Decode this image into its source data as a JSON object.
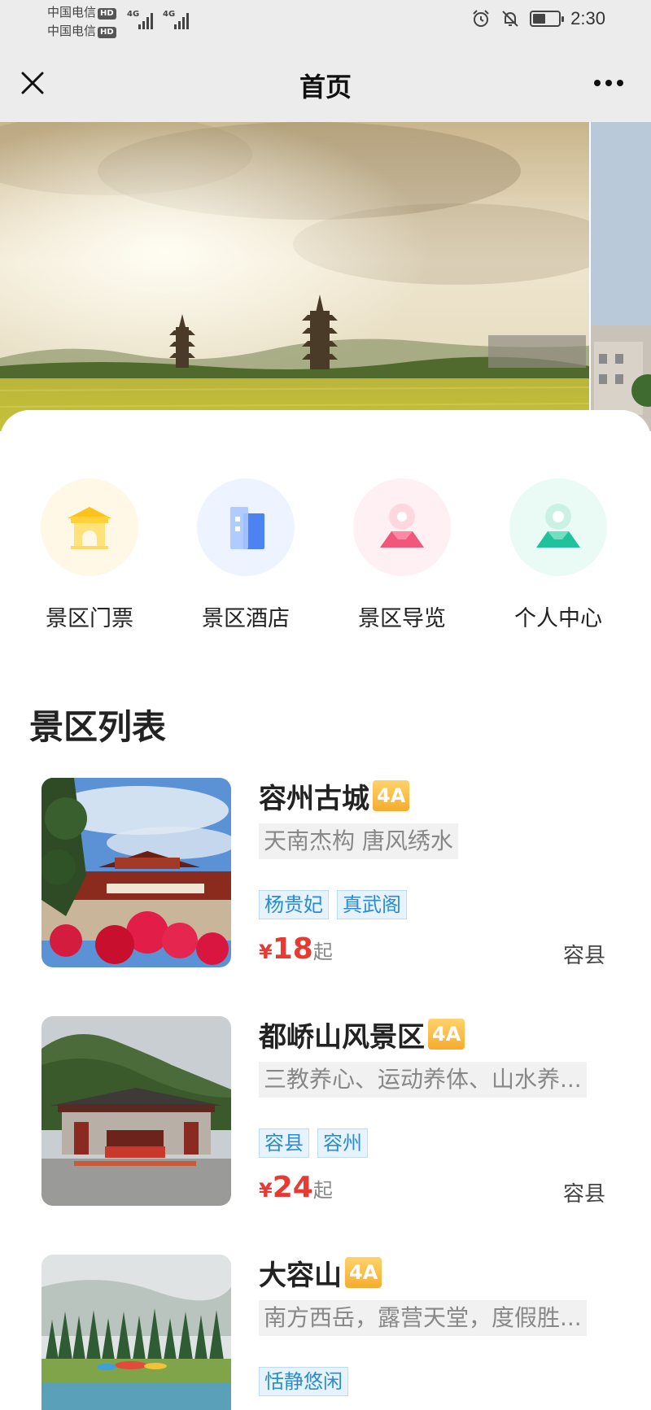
{
  "status": {
    "carrier1": "中国电信",
    "carrier2": "中国电信",
    "hd": "HD",
    "net": "4G",
    "time": "2:30",
    "battery_level": 0.5
  },
  "nav": {
    "title": "首页"
  },
  "quick_entries": [
    {
      "label": "景区门票",
      "icon": "gate-icon",
      "bg": "#fff8e6"
    },
    {
      "label": "景区酒店",
      "icon": "hotel-building-icon",
      "bg": "#eef4ff"
    },
    {
      "label": "景区导览",
      "icon": "map-pin-icon",
      "bg": "#fff0f3"
    },
    {
      "label": "个人中心",
      "icon": "user-icon",
      "bg": "#eafaf5"
    }
  ],
  "section": {
    "title": "景区列表"
  },
  "scenic_spots": [
    {
      "name": "容州古城",
      "level": "4A",
      "slogan": "天南杰构 唐风绣水",
      "tags": [
        "杨贵妃",
        "真武阁"
      ],
      "currency": "¥",
      "price": "18",
      "price_suffix": "起",
      "location": "容县"
    },
    {
      "name": "都峤山风景区",
      "level": "4A",
      "slogan": "三教养心、运动养体、山水养...",
      "tags": [
        "容县",
        "容州"
      ],
      "currency": "¥",
      "price": "24",
      "price_suffix": "起",
      "location": "容县"
    },
    {
      "name": "大容山",
      "level": "4A",
      "slogan": "南方西岳，露营天堂，度假胜...",
      "tags": [
        "恬静悠闲"
      ]
    }
  ],
  "colors": {
    "price": "#e63a33",
    "tag_text": "#2a8bd2",
    "level_badge": "#f5ac2e"
  }
}
